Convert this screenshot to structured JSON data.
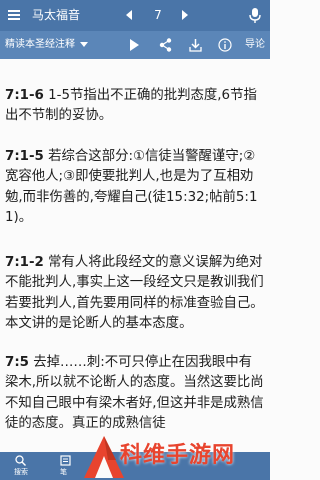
{
  "header": {
    "book_title": "马太福音",
    "chapter_number": "7"
  },
  "toolbar": {
    "version_label": "精读本圣经注释",
    "guide_label": "导论"
  },
  "verses": [
    {
      "ref": "7:1-6",
      "text": " 1-5节指出不正确的批判态度,6节指出不节制的妥协。"
    },
    {
      "ref": "7:1-5",
      "text": " 若综合这部分:①信徒当警醒谨守;②宽容他人;③即使要批判人,也是为了互相劝勉,而非伤善的,夸耀自己(徒15:32;帖前5:11)。"
    },
    {
      "ref": "7:1-2",
      "text": " 常有人将此段经文的意义误解为绝对不能批判人,事实上这一段经文只是教训我们若要批判人,首先要用同样的标准查验自己。本文讲的是论断人的基本态度。"
    },
    {
      "ref": "7:5",
      "text": " 去掉……刺:不可只停止在因我眼中有梁木,所以就不论断人的态度。当然这要比尚不知自己眼中有梁木者好,但这并非是成熟信徒的态度。真正的成熟信徒"
    }
  ],
  "bottom_nav": {
    "search_label": "搜索",
    "notes_label": "笔"
  },
  "watermark": {
    "text": "科维手游网"
  },
  "colors": {
    "primary": "#4a75a8",
    "secondary": "#5b86b8",
    "text": "#1e1e1e",
    "watermark": "#e8442e"
  },
  "icons": [
    "menu-icon",
    "chevron-left-icon",
    "chevron-right-icon",
    "microphone-icon",
    "dropdown-arrow-icon",
    "play-icon",
    "share-icon",
    "download-icon",
    "info-icon",
    "search-icon",
    "notes-icon",
    "watermark-logo-icon"
  ]
}
